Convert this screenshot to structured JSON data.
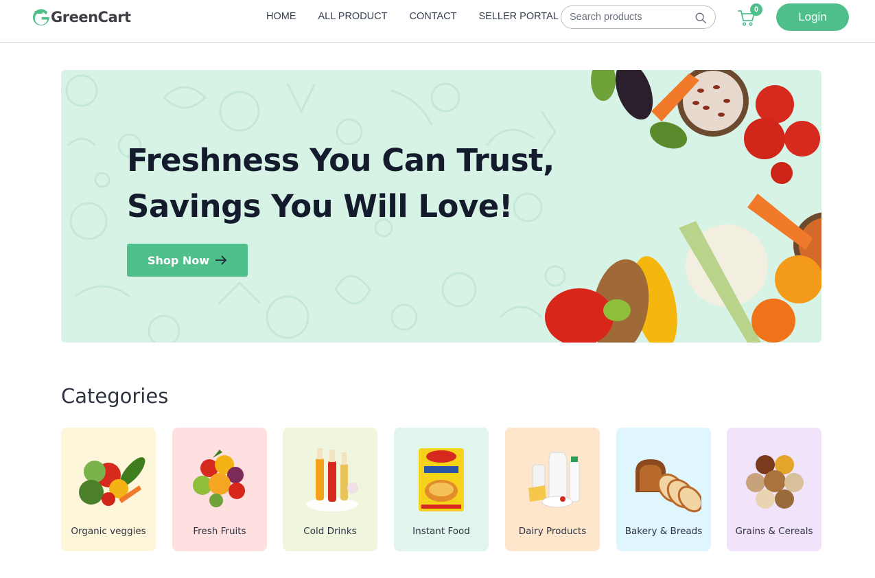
{
  "brand": {
    "name": "GreenCart",
    "accent": "#4fbf8b"
  },
  "nav": {
    "links": [
      {
        "label": "HOME"
      },
      {
        "label": "ALL PRODUCT"
      },
      {
        "label": "CONTACT"
      },
      {
        "label": "SELLER PORTAL"
      }
    ],
    "search": {
      "placeholder": "Search products",
      "icon": "search-icon"
    },
    "cart": {
      "icon": "cart-icon",
      "count": "0"
    },
    "login_label": "Login"
  },
  "hero": {
    "title_line1": "Freshness You Can Trust,",
    "title_line2": "Savings You Will Love!",
    "cta_label": "Shop Now",
    "cta_icon": "arrow-right-icon",
    "background": "#d7f3e6"
  },
  "categories": {
    "heading": "Categories",
    "items": [
      {
        "label": "Organic veggies",
        "color": "#fef6da",
        "icon": "vegetables-image"
      },
      {
        "label": "Fresh Fruits",
        "color": "#fee0e0",
        "icon": "fruits-image"
      },
      {
        "label": "Cold Drinks",
        "color": "#f0f5de",
        "icon": "drinks-image"
      },
      {
        "label": "Instant Food",
        "color": "#e1f5ec",
        "icon": "instant-noodles-image"
      },
      {
        "label": "Dairy Products",
        "color": "#fee6cd",
        "icon": "dairy-image"
      },
      {
        "label": "Bakery & Breads",
        "color": "#e0f6fe",
        "icon": "bread-image"
      },
      {
        "label": "Grains & Cereals",
        "color": "#f1e3f9",
        "icon": "grains-image"
      }
    ]
  }
}
